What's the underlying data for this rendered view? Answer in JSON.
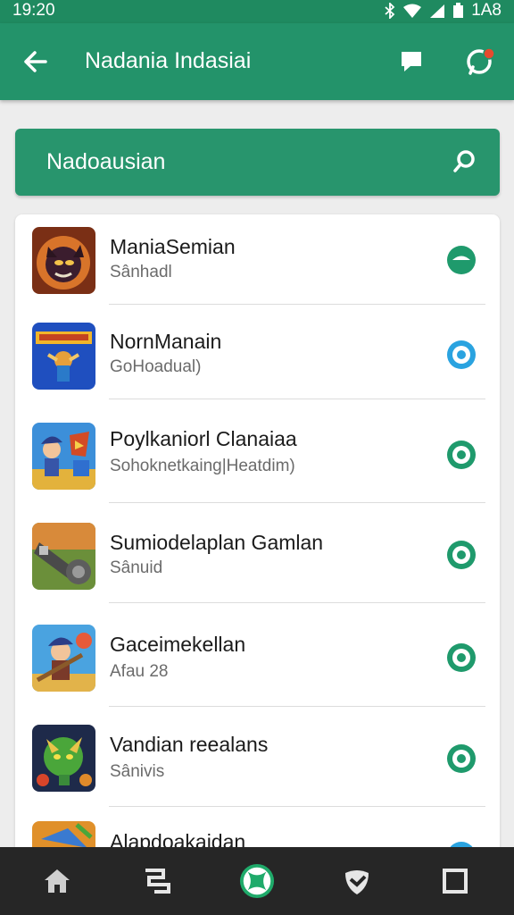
{
  "status_bar": {
    "time": "19:20",
    "right_text": "1A8"
  },
  "app_bar": {
    "title": "Nadania Indasiai"
  },
  "search": {
    "text": "Nadoausian"
  },
  "apps": [
    {
      "name": "ManiaSemian",
      "subtitle": "Sânhadl",
      "status_color": "#1f9a6c",
      "status_style": "filled"
    },
    {
      "name": "NornManain",
      "subtitle": "GoHoadual)",
      "status_color": "#2aa3e0",
      "status_style": "ring"
    },
    {
      "name": "Poylkaniorl Clanaiaa",
      "subtitle": "Sohoknetkaing|Heatdim)",
      "status_color": "#1f9a6c",
      "status_style": "ring"
    },
    {
      "name": "Sumiodelaplan Gamlan",
      "subtitle": "Sânuid",
      "status_color": "#1f9a6c",
      "status_style": "ring"
    },
    {
      "name": "Gaceimekellan",
      "subtitle": "Afau 28",
      "status_color": "#1f9a6c",
      "status_style": "ring"
    },
    {
      "name": "Vandian reealans",
      "subtitle": "Sânivis",
      "status_color": "#1f9a6c",
      "status_style": "ring"
    },
    {
      "name": "Alapdoakaidan",
      "subtitle": "",
      "status_color": "#2aa3e0",
      "status_style": "ring"
    }
  ],
  "colors": {
    "accent": "#23936a",
    "nav_bar": "#262626"
  },
  "icons": {
    "app_bar": [
      "back-arrow-icon",
      "chat-icon",
      "notification-chat-icon"
    ],
    "nav": [
      "home-icon",
      "recent-icon",
      "xbox-icon",
      "shield-icon",
      "square-icon"
    ]
  }
}
